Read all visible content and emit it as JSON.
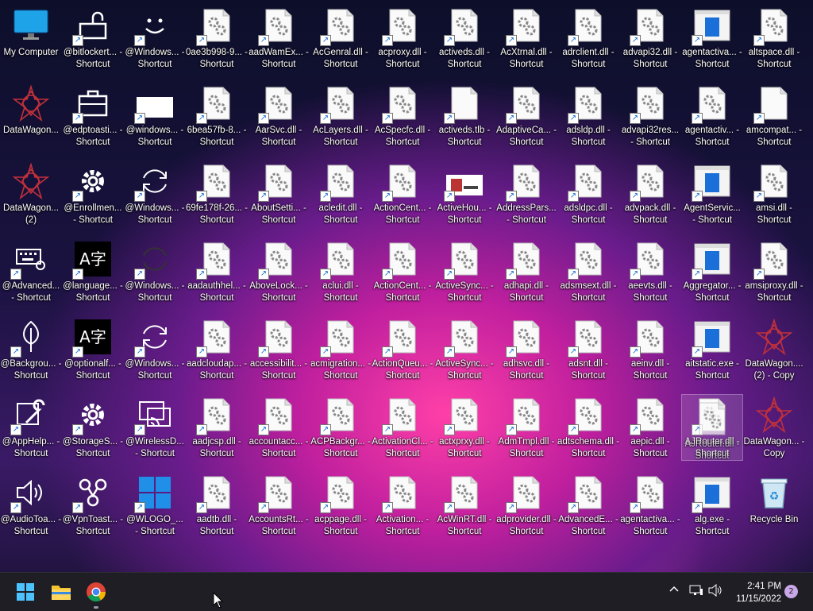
{
  "desktop": {
    "icons": [
      {
        "label": "My Computer",
        "kind": "monitor",
        "shortcut": false
      },
      {
        "label": "@bitlockert... - Shortcut",
        "kind": "lock",
        "shortcut": true
      },
      {
        "label": "@Windows... - Shortcut",
        "kind": "smile",
        "shortcut": true
      },
      {
        "label": "0ae3b998-9... - Shortcut",
        "kind": "dll",
        "shortcut": true
      },
      {
        "label": "aadWamEx... - Shortcut",
        "kind": "dll",
        "shortcut": true
      },
      {
        "label": "AcGenral.dll - Shortcut",
        "kind": "dll",
        "shortcut": true
      },
      {
        "label": "acproxy.dll - Shortcut",
        "kind": "dll",
        "shortcut": true
      },
      {
        "label": "activeds.dll - Shortcut",
        "kind": "dll",
        "shortcut": true
      },
      {
        "label": "AcXtrnal.dll - Shortcut",
        "kind": "dll",
        "shortcut": true
      },
      {
        "label": "adrclient.dll - Shortcut",
        "kind": "dll",
        "shortcut": true
      },
      {
        "label": "advapi32.dll - Shortcut",
        "kind": "dll",
        "shortcut": true
      },
      {
        "label": "agentactiva... - Shortcut",
        "kind": "exe",
        "shortcut": true
      },
      {
        "label": "altspace.dll - Shortcut",
        "kind": "dll",
        "shortcut": true
      },
      {
        "label": "DataWagon...",
        "kind": "star",
        "shortcut": false
      },
      {
        "label": "@edptoasti... - Shortcut",
        "kind": "briefcase",
        "shortcut": true
      },
      {
        "label": "@windows... - Shortcut",
        "kind": "white",
        "shortcut": true
      },
      {
        "label": "6bea57fb-8... - Shortcut",
        "kind": "dll",
        "shortcut": true
      },
      {
        "label": "AarSvc.dll - Shortcut",
        "kind": "dll",
        "shortcut": true
      },
      {
        "label": "AcLayers.dll - Shortcut",
        "kind": "dll",
        "shortcut": true
      },
      {
        "label": "AcSpecfc.dll - Shortcut",
        "kind": "dll",
        "shortcut": true
      },
      {
        "label": "activeds.tlb - Shortcut",
        "kind": "blank",
        "shortcut": true
      },
      {
        "label": "AdaptiveCa... - Shortcut",
        "kind": "dll",
        "shortcut": true
      },
      {
        "label": "adsldp.dll - Shortcut",
        "kind": "dll",
        "shortcut": true
      },
      {
        "label": "advapi32res... - Shortcut",
        "kind": "dll",
        "shortcut": true
      },
      {
        "label": "agentactiv... - Shortcut",
        "kind": "dll",
        "shortcut": true
      },
      {
        "label": "amcompat... - Shortcut",
        "kind": "blank",
        "shortcut": true
      },
      {
        "label": "DataWagon... (2)",
        "kind": "star",
        "shortcut": false
      },
      {
        "label": "@Enrollmen... - Shortcut",
        "kind": "gear",
        "shortcut": true
      },
      {
        "label": "@Windows... - Shortcut",
        "kind": "sync",
        "shortcut": true
      },
      {
        "label": "69fe178f-26... - Shortcut",
        "kind": "dll",
        "shortcut": true
      },
      {
        "label": "AboutSetti... - Shortcut",
        "kind": "dll",
        "shortcut": true
      },
      {
        "label": "acledit.dll - Shortcut",
        "kind": "dll",
        "shortcut": true
      },
      {
        "label": "ActionCent... - Shortcut",
        "kind": "dll",
        "shortcut": true
      },
      {
        "label": "ActiveHou... - Shortcut",
        "kind": "picture",
        "shortcut": true
      },
      {
        "label": "AddressPars... - Shortcut",
        "kind": "dll",
        "shortcut": true
      },
      {
        "label": "adsldpc.dll - Shortcut",
        "kind": "dll",
        "shortcut": true
      },
      {
        "label": "advpack.dll - Shortcut",
        "kind": "dll",
        "shortcut": true
      },
      {
        "label": "AgentServic... - Shortcut",
        "kind": "exe",
        "shortcut": true
      },
      {
        "label": "amsi.dll - Shortcut",
        "kind": "dll",
        "shortcut": true
      },
      {
        "label": "@Advanced... - Shortcut",
        "kind": "keyboard",
        "shortcut": true
      },
      {
        "label": "@language... - Shortcut",
        "kind": "lang",
        "shortcut": true
      },
      {
        "label": "@Windows... - Shortcut",
        "kind": "darksync",
        "shortcut": true
      },
      {
        "label": "aadauthhel... - Shortcut",
        "kind": "dll",
        "shortcut": true
      },
      {
        "label": "AboveLock... - Shortcut",
        "kind": "dll",
        "shortcut": true
      },
      {
        "label": "aclui.dll - Shortcut",
        "kind": "dll",
        "shortcut": true
      },
      {
        "label": "ActionCent... - Shortcut",
        "kind": "dll",
        "shortcut": true
      },
      {
        "label": "ActiveSync... - Shortcut",
        "kind": "dll",
        "shortcut": true
      },
      {
        "label": "adhapi.dll - Shortcut",
        "kind": "dll",
        "shortcut": true
      },
      {
        "label": "adsmsext.dll - Shortcut",
        "kind": "dll",
        "shortcut": true
      },
      {
        "label": "aeevts.dll - Shortcut",
        "kind": "dll",
        "shortcut": true
      },
      {
        "label": "Aggregator... - Shortcut",
        "kind": "exe",
        "shortcut": true
      },
      {
        "label": "amsiproxy.dll - Shortcut",
        "kind": "dll",
        "shortcut": true
      },
      {
        "label": "@Backgrou... - Shortcut",
        "kind": "leaf",
        "shortcut": true
      },
      {
        "label": "@optionalf... - Shortcut",
        "kind": "lang",
        "shortcut": true
      },
      {
        "label": "@Windows... - Shortcut",
        "kind": "sync",
        "shortcut": true
      },
      {
        "label": "aadcloudap... - Shortcut",
        "kind": "dll",
        "shortcut": true
      },
      {
        "label": "accessibilit... - Shortcut",
        "kind": "dll",
        "shortcut": true
      },
      {
        "label": "acmigration... - Shortcut",
        "kind": "dll",
        "shortcut": true
      },
      {
        "label": "ActionQueu... - Shortcut",
        "kind": "dll",
        "shortcut": true
      },
      {
        "label": "ActiveSync... - Shortcut",
        "kind": "dll",
        "shortcut": true
      },
      {
        "label": "adhsvc.dll - Shortcut",
        "kind": "dll",
        "shortcut": true
      },
      {
        "label": "adsnt.dll - Shortcut",
        "kind": "dll",
        "shortcut": true
      },
      {
        "label": "aeinv.dll - Shortcut",
        "kind": "dll",
        "shortcut": true
      },
      {
        "label": "aitstatic.exe - Shortcut",
        "kind": "exe",
        "shortcut": true
      },
      {
        "label": "DataWagon.... (2) - Copy",
        "kind": "star",
        "shortcut": false
      },
      {
        "label": "@AppHelp... - Shortcut",
        "kind": "wrench",
        "shortcut": true
      },
      {
        "label": "@StorageS... - Shortcut",
        "kind": "gear",
        "shortcut": true
      },
      {
        "label": "@WirelessD... - Shortcut",
        "kind": "cast",
        "shortcut": true
      },
      {
        "label": "aadjcsp.dll - Shortcut",
        "kind": "dll",
        "shortcut": true
      },
      {
        "label": "accountacc... - Shortcut",
        "kind": "dll",
        "shortcut": true
      },
      {
        "label": "ACPBackgr... - Shortcut",
        "kind": "dll",
        "shortcut": true
      },
      {
        "label": "ActivationCl... - Shortcut",
        "kind": "dll",
        "shortcut": true
      },
      {
        "label": "actxprxy.dll - Shortcut",
        "kind": "dll",
        "shortcut": true
      },
      {
        "label": "AdmTmpl.dll - Shortcut",
        "kind": "dll",
        "shortcut": true
      },
      {
        "label": "adtschema.dll - Shortcut",
        "kind": "dll",
        "shortcut": true
      },
      {
        "label": "aepic.dll - Shortcut",
        "kind": "dll",
        "shortcut": true
      },
      {
        "label": "AJRouter.dll - Shortcut",
        "kind": "dll",
        "shortcut": true
      },
      {
        "label": "DataWagon... - Copy",
        "kind": "star",
        "shortcut": false
      },
      {
        "label": "@AudioToa... - Shortcut",
        "kind": "speaker",
        "shortcut": true
      },
      {
        "label": "@VpnToast... - Shortcut",
        "kind": "vpn",
        "shortcut": true
      },
      {
        "label": "@WLOGO_... - Shortcut",
        "kind": "winlogo",
        "shortcut": true
      },
      {
        "label": "aadtb.dll - Shortcut",
        "kind": "dll",
        "shortcut": true
      },
      {
        "label": "AccountsRt... - Shortcut",
        "kind": "dll",
        "shortcut": true
      },
      {
        "label": "acppage.dll - Shortcut",
        "kind": "dll",
        "shortcut": true
      },
      {
        "label": "Activation... - Shortcut",
        "kind": "dll",
        "shortcut": true
      },
      {
        "label": "AcWinRT.dll - Shortcut",
        "kind": "dll",
        "shortcut": true
      },
      {
        "label": "adprovider.dll - Shortcut",
        "kind": "dll",
        "shortcut": true
      },
      {
        "label": "AdvancedE... - Shortcut",
        "kind": "dll",
        "shortcut": true
      },
      {
        "label": "agentactiva... - Shortcut",
        "kind": "dll",
        "shortcut": true
      },
      {
        "label": "alg.exe - Shortcut",
        "kind": "exe",
        "shortcut": true
      },
      {
        "label": "Recycle Bin",
        "kind": "recycle",
        "shortcut": false
      }
    ],
    "drag_ghost_label": "AJRouter.dll - Shortcut"
  },
  "taskbar": {
    "pinned": [
      "start-icon",
      "file-explorer-icon",
      "chrome-icon"
    ],
    "time": "2:41 PM",
    "date": "11/15/2022",
    "notification_count": "2"
  }
}
